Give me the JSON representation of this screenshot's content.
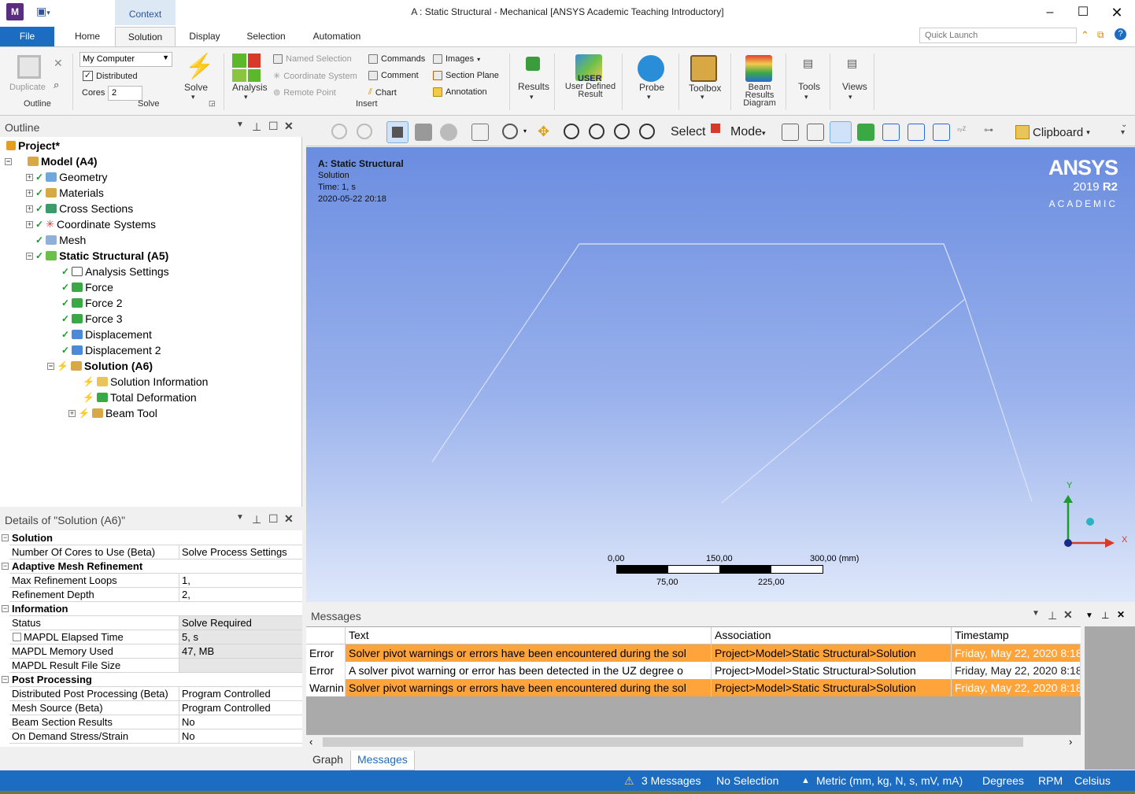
{
  "window": {
    "title": "A : Static Structural - Mechanical [ANSYS Academic Teaching Introductory]",
    "app_icon": "M",
    "context_tab": "Context"
  },
  "ribbon_tabs": [
    "File",
    "Home",
    "Solution",
    "Display",
    "Selection",
    "Automation"
  ],
  "quick_launch": {
    "placeholder": "Quick Launch"
  },
  "ribbon": {
    "outline_group": {
      "duplicate": "Duplicate",
      "label": "Outline"
    },
    "solve_group": {
      "machine": "My Computer",
      "distributed": "Distributed",
      "cores_label": "Cores",
      "cores_value": "2",
      "solve": "Solve",
      "label": "Solve"
    },
    "insert_group": {
      "analysis": "Analysis",
      "named_selection": "Named Selection",
      "coordinate_system": "Coordinate System",
      "remote_point": "Remote Point",
      "commands": "Commands",
      "comment": "Comment",
      "chart": "Chart",
      "images": "Images",
      "section_plane": "Section Plane",
      "annotation": "Annotation",
      "label": "Insert"
    },
    "results": "Results",
    "user_defined_result_icon_text": "USER",
    "user_defined_result": "User Defined Result",
    "probe": "Probe",
    "toolbox": "Toolbox",
    "beam_results_diagram": "Beam Results Diagram",
    "tools": "Tools",
    "views": "Views"
  },
  "outline": {
    "title": "Outline",
    "nodes": [
      {
        "label": "Project*"
      },
      {
        "label": "Model (A4)"
      },
      {
        "label": "Geometry"
      },
      {
        "label": "Materials"
      },
      {
        "label": "Cross Sections"
      },
      {
        "label": "Coordinate Systems"
      },
      {
        "label": "Mesh"
      },
      {
        "label": "Static Structural (A5)"
      },
      {
        "label": "Analysis Settings"
      },
      {
        "label": "Force"
      },
      {
        "label": "Force 2"
      },
      {
        "label": "Force 3"
      },
      {
        "label": "Displacement"
      },
      {
        "label": "Displacement 2"
      },
      {
        "label": "Solution (A6)"
      },
      {
        "label": "Solution Information"
      },
      {
        "label": "Total Deformation"
      },
      {
        "label": "Beam Tool"
      }
    ]
  },
  "details": {
    "title": "Details of \"Solution (A6)\"",
    "groups": [
      {
        "name": "Solution",
        "rows": [
          [
            "Number Of Cores to Use (Beta)",
            "Solve Process Settings"
          ]
        ]
      },
      {
        "name": "Adaptive Mesh Refinement",
        "rows": [
          [
            "Max Refinement Loops",
            "1,"
          ],
          [
            "Refinement Depth",
            "2,"
          ]
        ]
      },
      {
        "name": "Information",
        "rows": [
          [
            "Status",
            "Solve Required"
          ],
          [
            "MAPDL Elapsed Time",
            "5, s"
          ],
          [
            "MAPDL Memory Used",
            "47, MB"
          ],
          [
            "MAPDL Result File Size",
            ""
          ]
        ]
      },
      {
        "name": "Post Processing",
        "rows": [
          [
            "Distributed Post Processing (Beta)",
            "Program Controlled"
          ],
          [
            "Mesh Source (Beta)",
            "Program Controlled"
          ],
          [
            "Beam Section Results",
            "No"
          ],
          [
            "On Demand Stress/Strain",
            "No"
          ]
        ]
      }
    ]
  },
  "graphics_toolbar": {
    "select": "Select",
    "mode": "Mode",
    "clipboard": "Clipboard"
  },
  "viewport": {
    "analysis": "A: Static Structural",
    "object": "Solution",
    "time": "Time: 1, s",
    "date": "2020-05-22 20:18",
    "logo": "ANSYS",
    "version_year": "2019",
    "version_release": "R2",
    "edition": "ACADEMIC",
    "scale_labels_top": [
      "0,00",
      "150,00",
      "300,00 (mm)"
    ],
    "scale_labels_bottom": [
      "75,00",
      "225,00"
    ],
    "axis_x": "X",
    "axis_y": "Y"
  },
  "messages": {
    "title": "Messages",
    "columns": [
      "Text",
      "Association",
      "Timestamp"
    ],
    "rows": [
      {
        "type": "Error",
        "text": "Solver pivot warnings or errors have been encountered during the sol",
        "association": "Project>Model>Static Structural>Solution",
        "timestamp": "Friday, May 22, 2020 8:18"
      },
      {
        "type": "Error",
        "text": "A solver pivot warning or error has been detected in the UZ degree o",
        "association": "Project>Model>Static Structural>Solution",
        "timestamp": "Friday, May 22, 2020 8:18"
      },
      {
        "type": "Warnin",
        "text": "Solver pivot warnings or errors have been encountered during the sol",
        "association": "Project>Model>Static Structural>Solution",
        "timestamp": "Friday, May 22, 2020 8:18"
      }
    ],
    "tabs": [
      "Graph",
      "Messages"
    ]
  },
  "status_bar": {
    "messages": "3 Messages",
    "selection": "No Selection",
    "units": "Metric (mm, kg, N, s, mV, mA)",
    "angle": "Degrees",
    "speed": "RPM",
    "temperature": "Celsius"
  },
  "colors": {
    "accent": "#1c6dc2",
    "highlight_row": "#ffa43a",
    "viewport_top": "#6b8de0",
    "check": "#1a9c2a",
    "bolt": "#e03a1c"
  }
}
